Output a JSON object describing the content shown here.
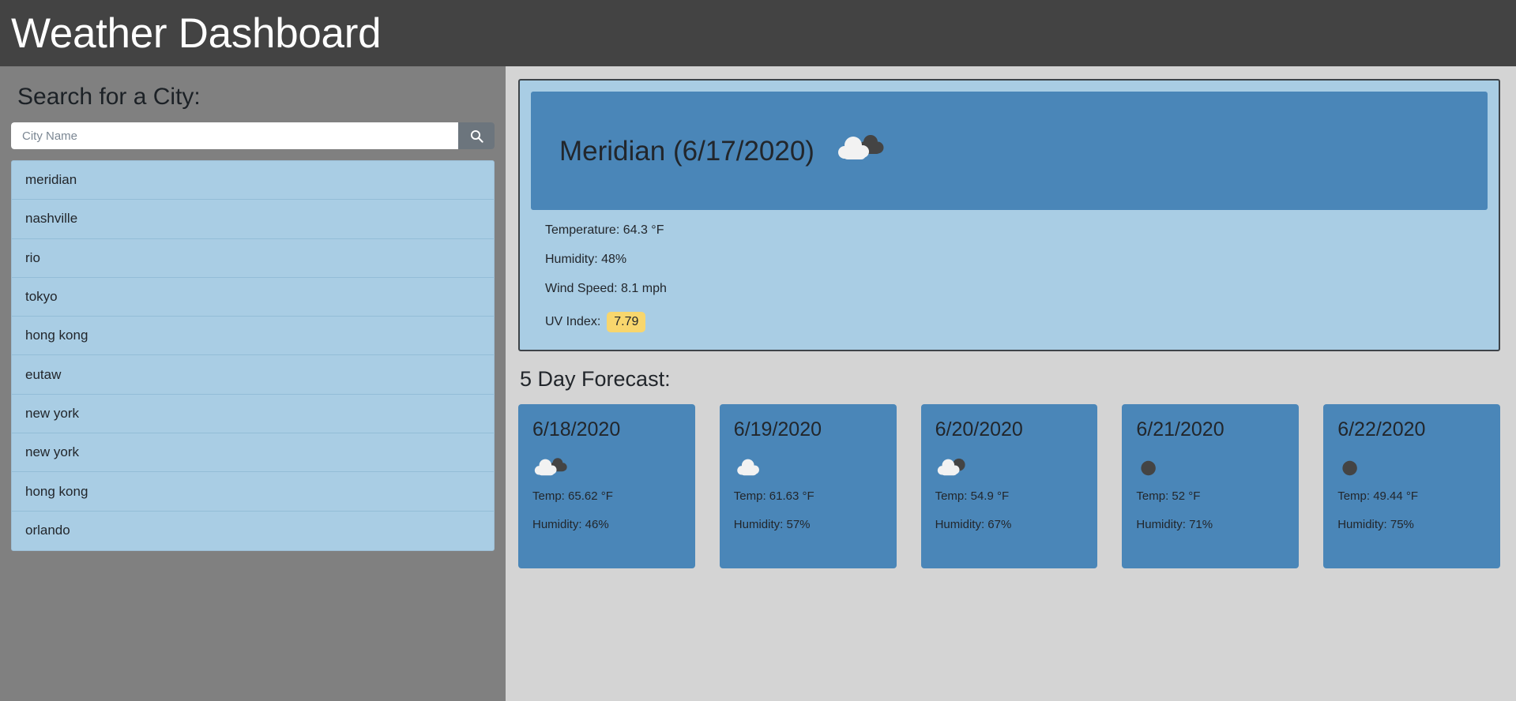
{
  "header": {
    "title": "Weather Dashboard"
  },
  "sidebar": {
    "search_heading": "Search for a City:",
    "search_placeholder": "City Name",
    "search_value": "",
    "search_button_icon": "search-icon",
    "history": [
      {
        "name": "meridian"
      },
      {
        "name": "nashville"
      },
      {
        "name": "rio"
      },
      {
        "name": "tokyo"
      },
      {
        "name": "hong kong"
      },
      {
        "name": "eutaw"
      },
      {
        "name": "new york"
      },
      {
        "name": "new york"
      },
      {
        "name": "hong kong"
      },
      {
        "name": "orlando"
      }
    ]
  },
  "current": {
    "title": "Meridian (6/17/2020)",
    "icon": "broken-clouds-icon",
    "temperature": "Temperature: 64.3 °F",
    "humidity": "Humidity: 48%",
    "wind": "Wind Speed: 8.1 mph",
    "uv_label": "UV Index:",
    "uv_value": "7.79",
    "uv_badge_color": "#f8d66d"
  },
  "forecast": {
    "heading": "5 Day Forecast:",
    "days": [
      {
        "date": "6/18/2020",
        "icon": "broken-clouds-icon",
        "temp": "Temp: 65.62 °F",
        "humidity": "Humidity: 46%"
      },
      {
        "date": "6/19/2020",
        "icon": "overcast-cloud-icon",
        "temp": "Temp: 61.63 °F",
        "humidity": "Humidity: 57%"
      },
      {
        "date": "6/20/2020",
        "icon": "few-clouds-icon",
        "temp": "Temp: 54.9 °F",
        "humidity": "Humidity: 67%"
      },
      {
        "date": "6/21/2020",
        "icon": "clear-sky-icon",
        "temp": "Temp: 52 °F",
        "humidity": "Humidity: 71%"
      },
      {
        "date": "6/22/2020",
        "icon": "clear-sky-icon",
        "temp": "Temp: 49.44 °F",
        "humidity": "Humidity: 75%"
      }
    ]
  },
  "colors": {
    "header_bg": "#434343",
    "sidebar_bg": "#808080",
    "main_bg": "#d4d4d4",
    "card_light_blue": "#a9cde4",
    "card_blue": "#4a86b8",
    "accent_yellow": "#f8d66d"
  }
}
